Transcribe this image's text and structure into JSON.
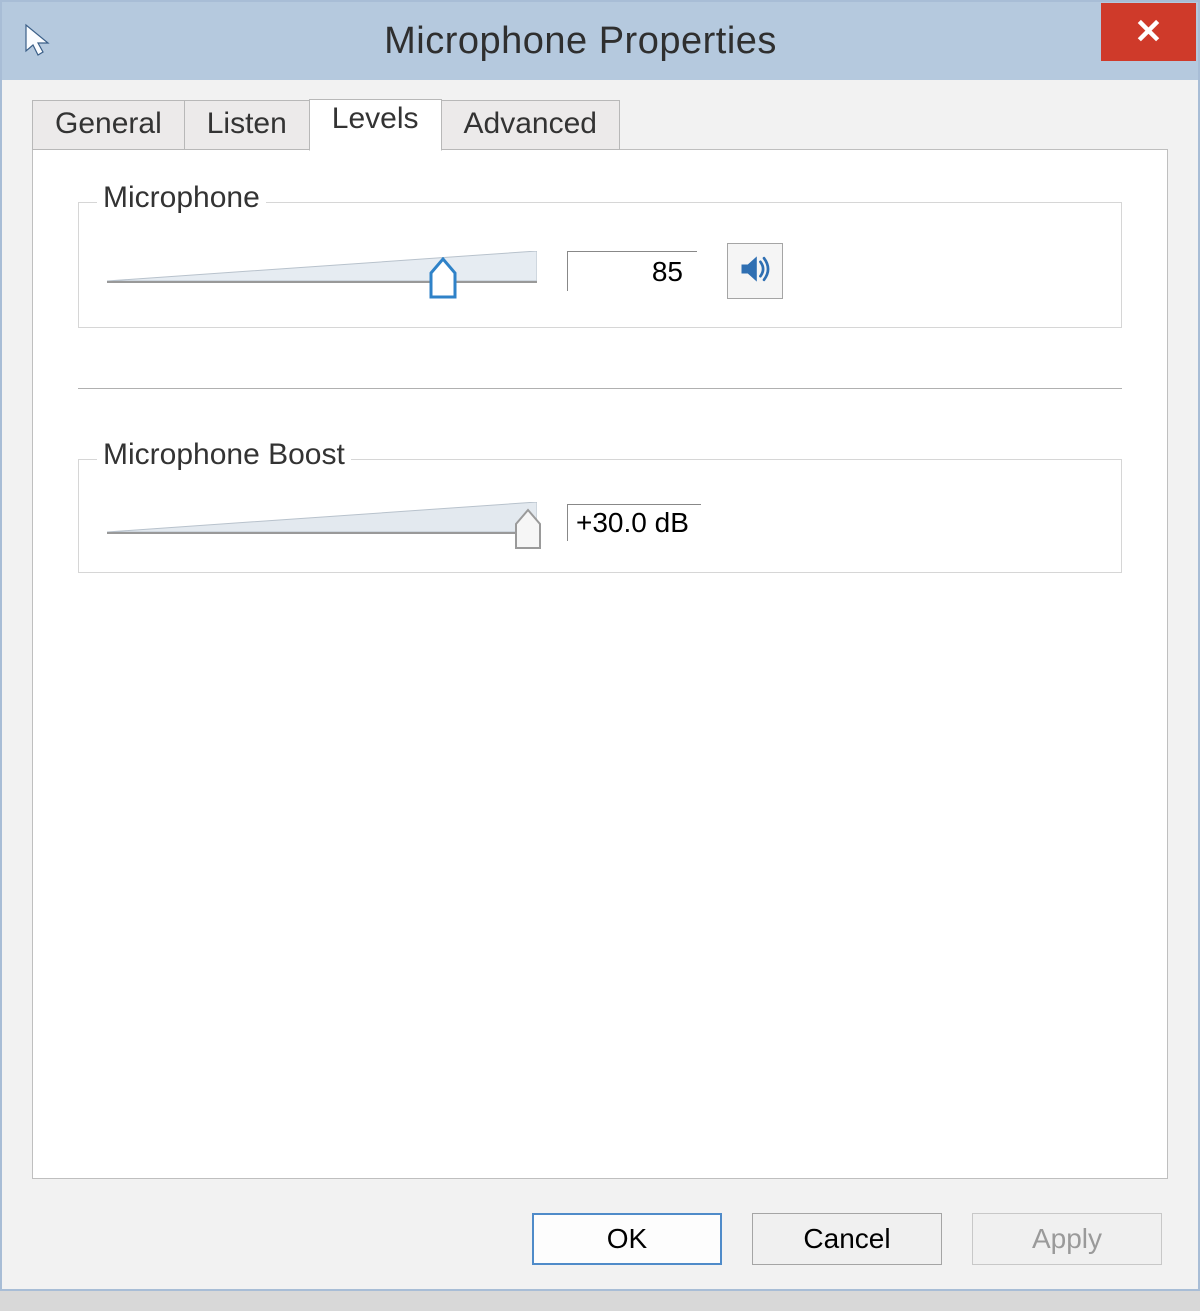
{
  "window": {
    "title": "Microphone Properties"
  },
  "tabs": {
    "items": [
      "General",
      "Listen",
      "Levels",
      "Advanced"
    ],
    "active_index": 2
  },
  "levels": {
    "microphone": {
      "label": "Microphone",
      "value": 85,
      "value_text": "85",
      "muted": false
    },
    "boost": {
      "label": "Microphone Boost",
      "value_text": "+30.0 dB",
      "percent": 100
    }
  },
  "buttons": {
    "ok": "OK",
    "cancel": "Cancel",
    "apply": "Apply"
  },
  "colors": {
    "titlebar": "#b5c9de",
    "close": "#cf3a2a",
    "accent": "#2f6fb2"
  }
}
